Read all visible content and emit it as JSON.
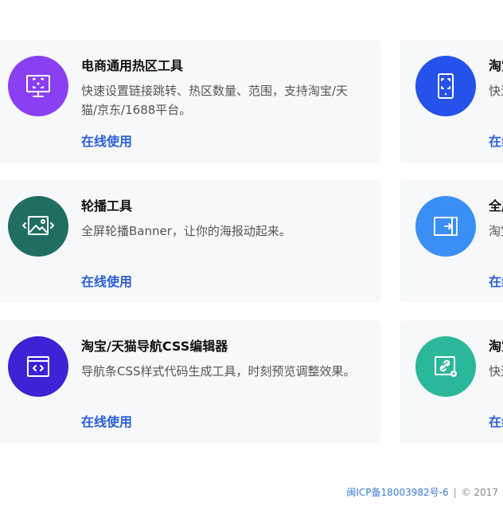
{
  "tools_left": [
    {
      "title": "电商通用热区工具",
      "desc": "快速设置链接跳转、热区数量、范围，支持淘宝/天猫/京东/1688平台。",
      "link": "在线使用",
      "icon": "monitor-hotspot-icon",
      "color": "#8a3ff2"
    },
    {
      "title": "轮播工具",
      "desc": "全屏轮播Banner，让你的海报动起来。",
      "link": "在线使用",
      "icon": "image-carousel-icon",
      "color": "#1f6e61"
    },
    {
      "title": "淘宝/天猫导航CSS编辑器",
      "desc": "导航条CSS样式代码生成工具，时刻预览调整效果。",
      "link": "在线使用",
      "icon": "code-window-icon",
      "color": "#3b23d6"
    }
  ],
  "tools_right": [
    {
      "title": "淘宝",
      "desc": "快速",
      "link": "在线",
      "icon": "mobile-hotspot-icon",
      "color": "#2552ea"
    },
    {
      "title": "全屏",
      "desc": "淘宝来选",
      "link": "在线",
      "icon": "fullscreen-arrow-icon",
      "color": "#3a8ff5"
    },
    {
      "title": "淘宝",
      "desc": "快速",
      "link": "在线",
      "icon": "link-edit-icon",
      "color": "#2bb89a"
    }
  ],
  "footer": {
    "icp": "闽ICP备18003982号-6",
    "separator": "|",
    "copyright": "© 2017"
  }
}
